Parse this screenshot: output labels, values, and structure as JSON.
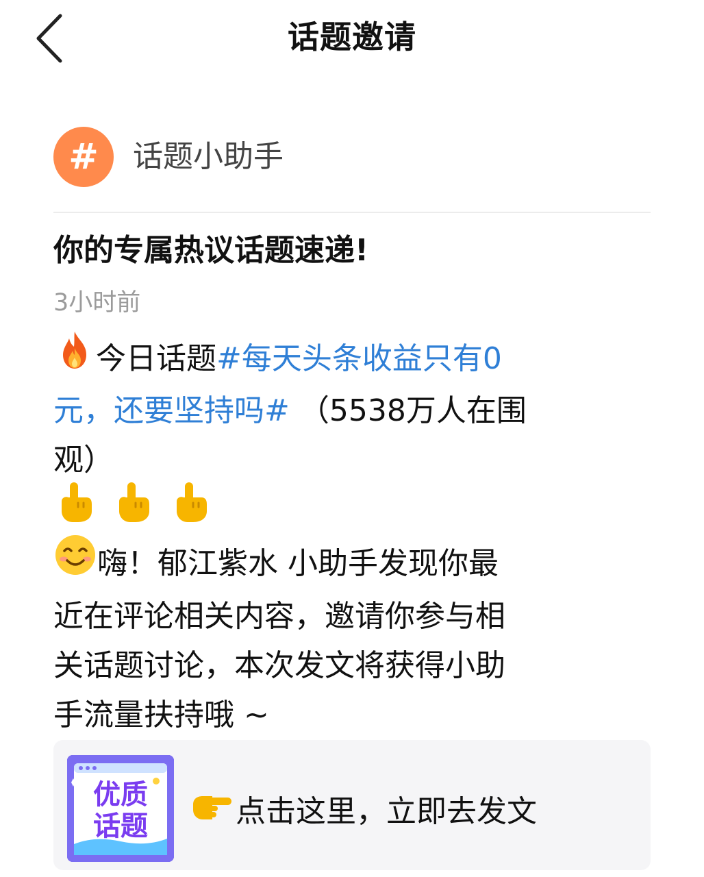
{
  "nav": {
    "title": "话题邀请",
    "back_icon": "chevron-left-icon"
  },
  "sender": {
    "avatar_symbol": "#",
    "avatar_color": "#ff8a4c",
    "name": "话题小助手"
  },
  "message": {
    "title": "你的专属热议话题速递!",
    "time": "3小时前",
    "line1_prefix": "今日话题",
    "topic_part1": "#每天头条收益只有0",
    "topic_part2": "元，还要坚持吗#",
    "line2_suffix": " （5538万人在围",
    "line3": "观）",
    "greeting_line1": "嗨！郁江紫水 小助手发现你最",
    "greeting_line2": "近在评论相关内容，邀请你参与相",
    "greeting_line3": "关话题讨论，本次发文将获得小助",
    "greeting_line4": "手流量扶持哦 ~",
    "link_color": "#2f7fd6"
  },
  "card": {
    "thumb_line1": "优质",
    "thumb_line2": "话题",
    "action_text": "点击这里，立即去发文",
    "pointer_icon": "pointing-right-hand-icon"
  }
}
